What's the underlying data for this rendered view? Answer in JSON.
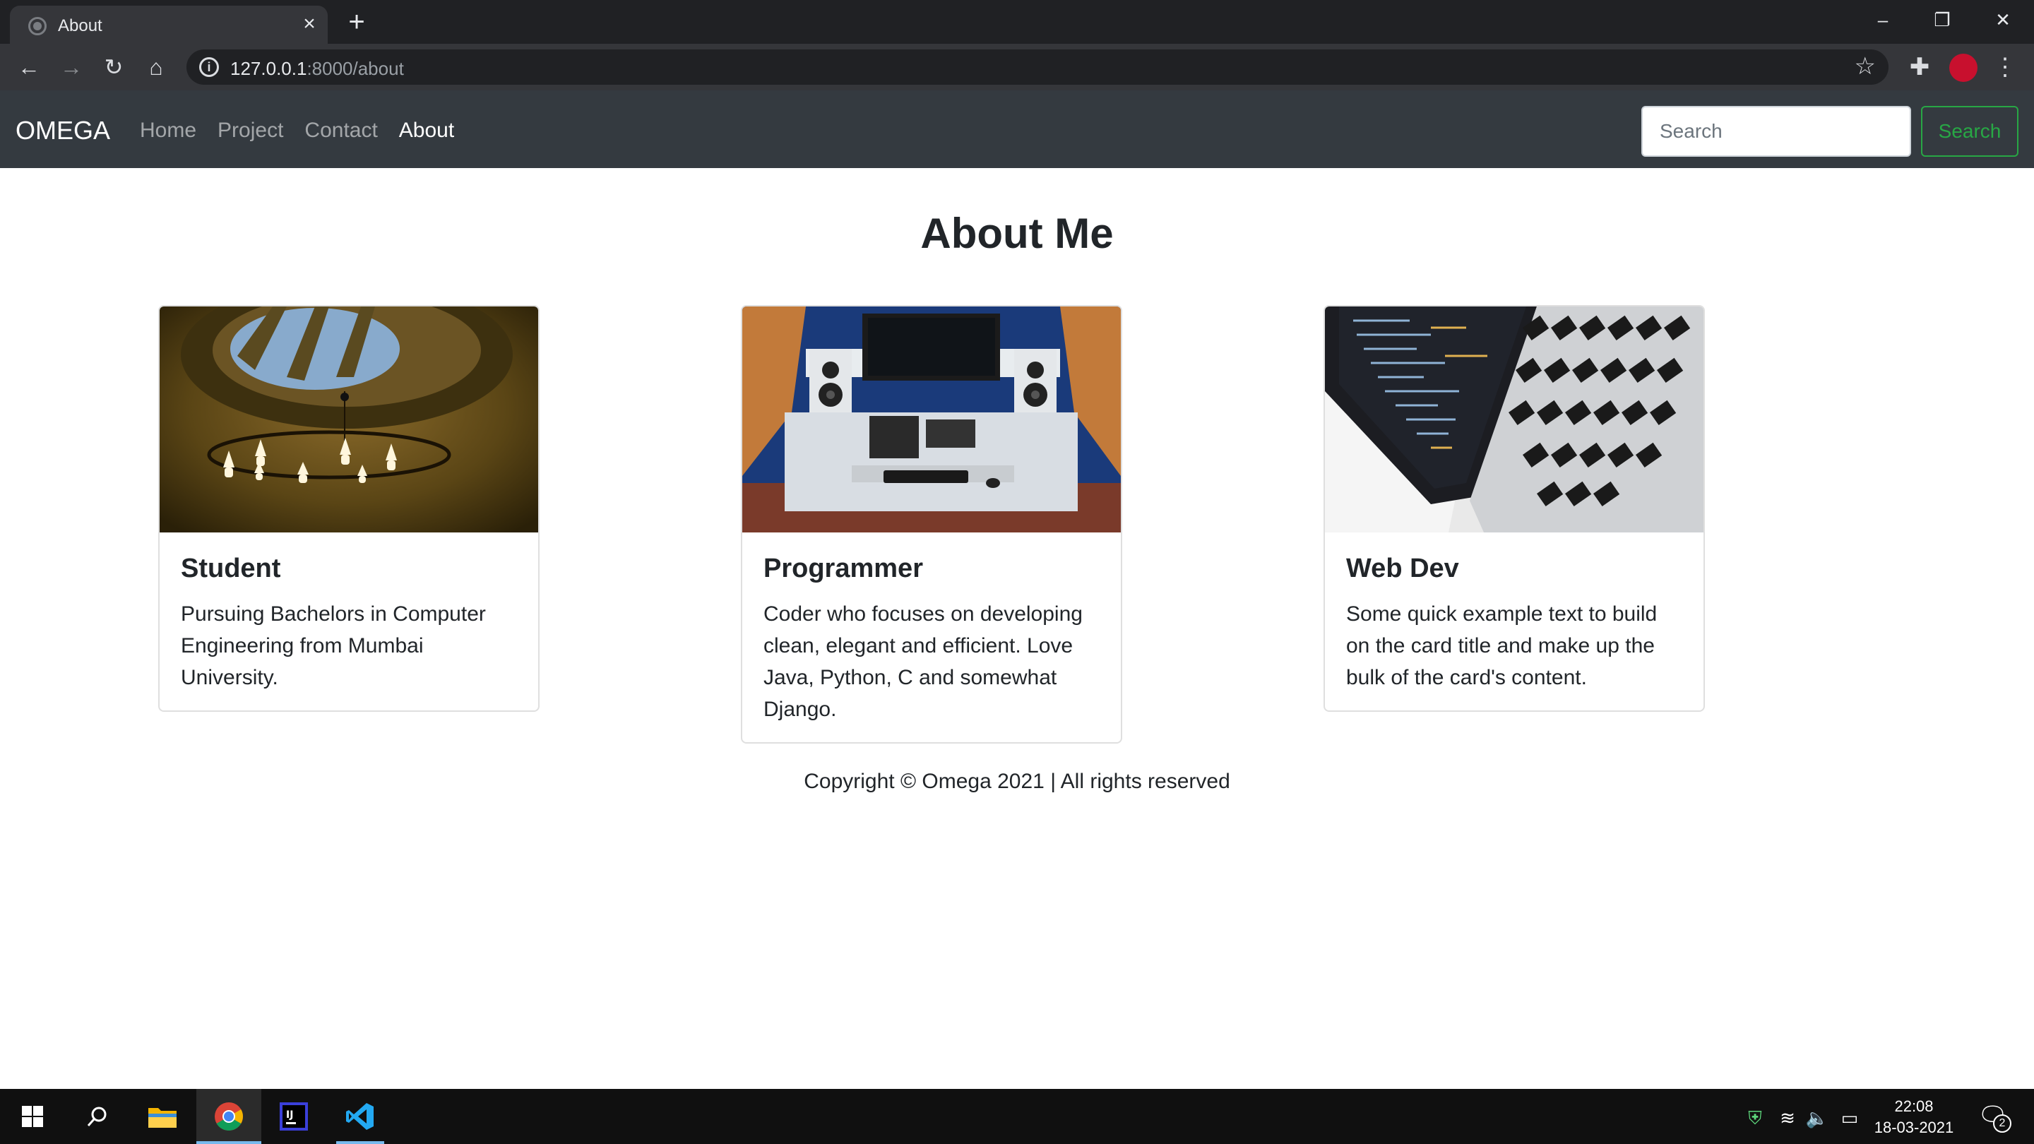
{
  "browser": {
    "tab_title": "About",
    "url_host": "127.0.0.1",
    "url_rest": ":8000/about"
  },
  "navbar": {
    "brand": "OMEGA",
    "links": [
      {
        "label": "Home",
        "active": false
      },
      {
        "label": "Project",
        "active": false
      },
      {
        "label": "Contact",
        "active": false
      },
      {
        "label": "About",
        "active": true
      }
    ],
    "search_placeholder": "Search",
    "search_button": "Search"
  },
  "page": {
    "title": "About Me",
    "cards": [
      {
        "title": "Student",
        "text": "Pursuing Bachelors in Computer Engineering from Mumbai University.",
        "image": "ceiling-chandelier-photo"
      },
      {
        "title": "Programmer",
        "text": "Coder who focuses on developing clean, elegant and efficient. Love Java, Python, C and somewhat Django.",
        "image": "studio-desk-photo"
      },
      {
        "title": "Web Dev",
        "text": "Some quick example text to build on the card title and make up the bulk of the card's content.",
        "image": "laptop-code-photo"
      }
    ],
    "footer": "Copyright © Omega 2021 | All rights reserved"
  },
  "taskbar": {
    "apps": [
      "start-icon",
      "search-icon",
      "file-explorer-icon",
      "chrome-icon",
      "intellij-icon",
      "vscode-icon"
    ],
    "time": "22:08",
    "date": "18-03-2021",
    "notification_count": "2"
  },
  "colors": {
    "navbar_bg": "#343a40",
    "search_button": "#28a745",
    "profile_avatar": "#c8102e"
  }
}
